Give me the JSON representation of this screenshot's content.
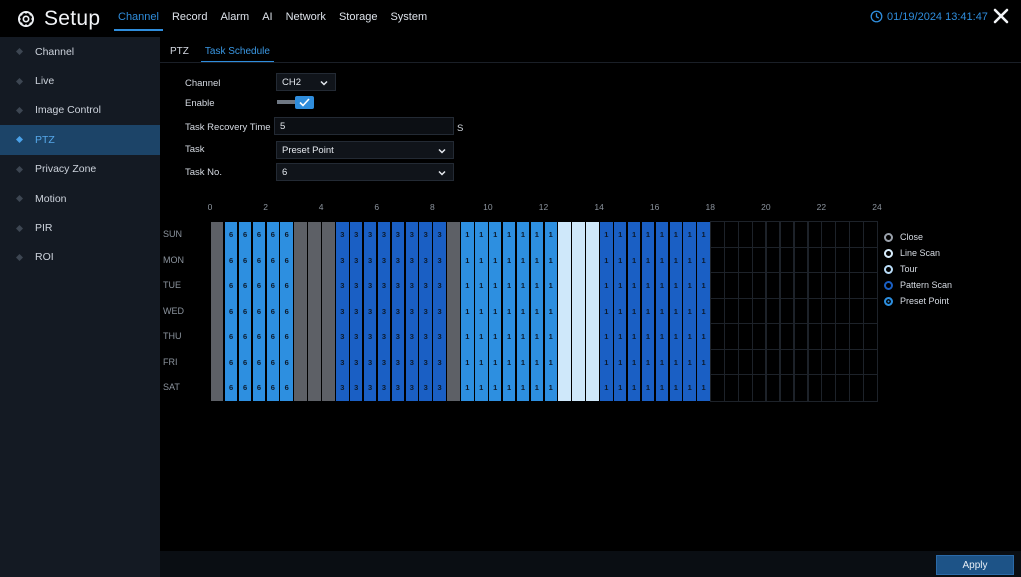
{
  "app": {
    "title": "Setup"
  },
  "top_menu": [
    {
      "label": "Channel",
      "active": true
    },
    {
      "label": "Record",
      "active": false
    },
    {
      "label": "Alarm",
      "active": false
    },
    {
      "label": "AI",
      "active": false
    },
    {
      "label": "Network",
      "active": false
    },
    {
      "label": "Storage",
      "active": false
    },
    {
      "label": "System",
      "active": false
    }
  ],
  "datetime": "01/19/2024 13:41:47",
  "sidebar": {
    "items": [
      {
        "label": "Channel",
        "active": false
      },
      {
        "label": "Live",
        "active": false
      },
      {
        "label": "Image Control",
        "active": false
      },
      {
        "label": "PTZ",
        "active": true
      },
      {
        "label": "Privacy Zone",
        "active": false
      },
      {
        "label": "Motion",
        "active": false
      },
      {
        "label": "PIR",
        "active": false
      },
      {
        "label": "ROI",
        "active": false
      }
    ]
  },
  "tabs": [
    {
      "label": "PTZ",
      "active": false
    },
    {
      "label": "Task Schedule",
      "active": true
    }
  ],
  "form": {
    "channel_label": "Channel",
    "channel_value": "CH2",
    "enable_label": "Enable",
    "enable_checked": true,
    "recovery_label": "Task Recovery Time",
    "recovery_value": "5",
    "recovery_unit": "S",
    "task_label": "Task",
    "task_value": "Preset Point",
    "task_no_label": "Task No.",
    "task_no_value": "6"
  },
  "schedule": {
    "hour_labels": [
      "0",
      "2",
      "4",
      "6",
      "8",
      "10",
      "12",
      "14",
      "16",
      "18",
      "20",
      "22",
      "24"
    ],
    "days": [
      "SUN",
      "MON",
      "TUE",
      "WED",
      "THU",
      "FRI",
      "SAT"
    ],
    "segments": [
      {
        "start": 0.0,
        "end": 0.5,
        "type": "gray",
        "label": ""
      },
      {
        "start": 0.5,
        "end": 3.0,
        "type": "preset",
        "label": "6"
      },
      {
        "start": 3.0,
        "end": 4.5,
        "type": "gray",
        "label": ""
      },
      {
        "start": 4.5,
        "end": 8.5,
        "type": "tour",
        "label": "3"
      },
      {
        "start": 8.5,
        "end": 9.0,
        "type": "gray",
        "label": ""
      },
      {
        "start": 9.0,
        "end": 12.5,
        "type": "preset",
        "label": "1"
      },
      {
        "start": 12.5,
        "end": 14.0,
        "type": "linescan",
        "label": ""
      },
      {
        "start": 14.0,
        "end": 18.0,
        "type": "tour",
        "label": "1"
      }
    ],
    "colors": {
      "gray": "#5d6066",
      "preset": "#2d8fe0",
      "tour": "#1a5fc4",
      "linescan": "#cfe8fa",
      "empty": "#000000"
    }
  },
  "legend": [
    {
      "label": "Close",
      "color": "#9aa1ab"
    },
    {
      "label": "Line Scan",
      "color": "#d7ecfb"
    },
    {
      "label": "Tour",
      "color": "#b9dcf7"
    },
    {
      "label": "Pattern Scan",
      "color": "#1a5fc4"
    },
    {
      "label": "Preset Point",
      "color": "#2d8fe0"
    }
  ],
  "apply_label": "Apply",
  "icons": {
    "logo": "gear-icon",
    "clock": "clock-icon",
    "close": "close-icon",
    "sidebar_bullet": "diamond-icon",
    "dropdown": "chevron-down-icon",
    "checkbox": "check-icon"
  }
}
